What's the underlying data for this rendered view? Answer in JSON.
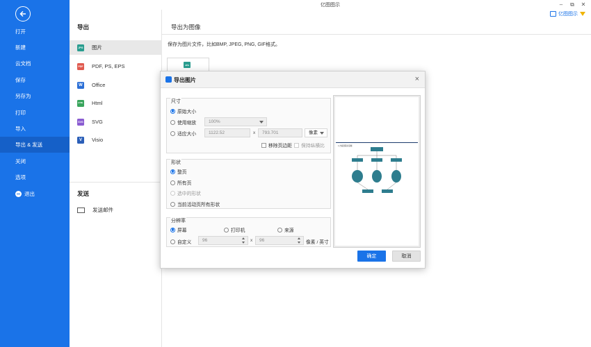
{
  "app": {
    "title": "亿图图示",
    "brand": "亿图图示"
  },
  "window_controls": {
    "minimize": "–",
    "restore": "⧉",
    "close": "✕"
  },
  "leftnav": {
    "items": [
      {
        "label": "打开",
        "name": "nav-open"
      },
      {
        "label": "新建",
        "name": "nav-new"
      },
      {
        "label": "云文档",
        "name": "nav-cloud"
      },
      {
        "label": "保存",
        "name": "nav-save"
      },
      {
        "label": "另存为",
        "name": "nav-save-as"
      },
      {
        "label": "打印",
        "name": "nav-print"
      },
      {
        "label": "导入",
        "name": "nav-import"
      },
      {
        "label": "导出 & 发送",
        "name": "nav-export-send"
      },
      {
        "label": "关闭",
        "name": "nav-close"
      },
      {
        "label": "选项",
        "name": "nav-options"
      },
      {
        "label": "退出",
        "name": "nav-exit"
      }
    ]
  },
  "midmenu": {
    "export_title": "导出",
    "formats": [
      {
        "label": "图片",
        "icon": "jpg-icon",
        "icon_text": "JPG",
        "color": "#2a9d8f"
      },
      {
        "label": "PDF, PS, EPS",
        "icon": "pdf-icon",
        "icon_text": "PDF",
        "color": "#e05a4f"
      },
      {
        "label": "Office",
        "icon": "word-icon",
        "icon_text": "W",
        "color": "#2b6fd6"
      },
      {
        "label": "Html",
        "icon": "html-icon",
        "icon_text": "HTML",
        "color": "#3aa55d"
      },
      {
        "label": "SVG",
        "icon": "svg-icon",
        "icon_text": "SVG",
        "color": "#8a5cd1"
      },
      {
        "label": "Visio",
        "icon": "visio-icon",
        "icon_text": "V",
        "color": "#2b5fb8"
      }
    ],
    "send_title": "发送",
    "send_mail": "发送邮件"
  },
  "main": {
    "title": "导出为图像",
    "description": "保存为图片文件，比如BMP, JPEG, PNG, GIF格式。",
    "card_icon_text": "JPG"
  },
  "dialog": {
    "title": "导出图片",
    "size": {
      "label": "尺寸",
      "original": "原始大小",
      "use_zoom": "使用缩放",
      "zoom_value": "100%",
      "fit_size": "适应大小",
      "width": "1122.52",
      "height": "793.701",
      "unit": "像素",
      "remove_margin": "移除页边距",
      "keep_ratio": "保持纵横比"
    },
    "shape": {
      "label": "形状",
      "whole_page": "整页",
      "all_pages": "所有页",
      "selected": "选中的形状",
      "active_page_all": "当前活动页所有形状"
    },
    "resolution": {
      "label": "分辨率",
      "screen": "屏幕",
      "printer": "打印机",
      "source": "来源",
      "custom": "自定义",
      "x_value": "96",
      "y_value": "96",
      "unit": "像素 / 英寸"
    },
    "times": "x",
    "ok": "确定",
    "cancel": "取消",
    "preview_title": "1.方案流程示意图"
  },
  "colors": {
    "accent": "#1a73e8",
    "nav_bg": "#1a73e8",
    "node": "#2e7d8e"
  }
}
